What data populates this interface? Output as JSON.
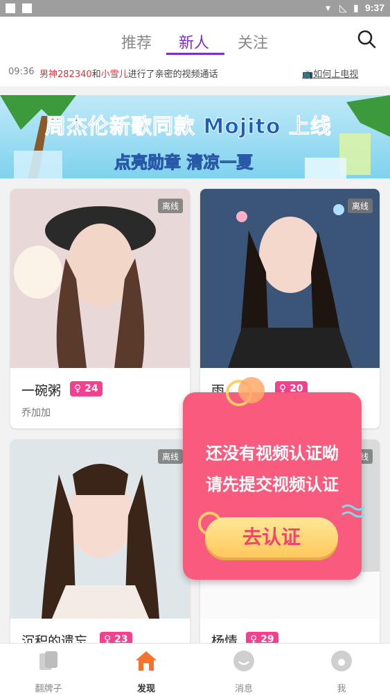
{
  "status_bar": {
    "time": "9:37"
  },
  "header": {
    "tabs": [
      {
        "label": "推荐"
      },
      {
        "label": "新人"
      },
      {
        "label": "关注"
      }
    ],
    "active_tab": "新人"
  },
  "ticker": {
    "time": "09:36",
    "user1": "男神282340",
    "and": "和",
    "user2": "小雪儿",
    "text": "进行了亲密的视频通话",
    "help_link": "如何上电视"
  },
  "banner": {
    "title": "周杰伦新歌同款 Mojito 上线",
    "subtitle": "点亮勋章  清凉一夏"
  },
  "cards": [
    {
      "status": "离线",
      "name": "一碗粥",
      "level": "24",
      "sub": "乔加加"
    },
    {
      "status": "离线",
      "name": "雨",
      "level": "20",
      "sub": ""
    },
    {
      "status": "离线",
      "name": "沉积的遗忘",
      "level": "23",
      "sub": ""
    },
    {
      "status": "离线",
      "name": "杨情",
      "level": "29",
      "sub": ""
    }
  ],
  "popup": {
    "line1": "还没有视频认证呦",
    "line2": "请先提交视频认证",
    "button": "去认证"
  },
  "nav": [
    {
      "label": "翻牌子"
    },
    {
      "label": "发现"
    },
    {
      "label": "消息"
    },
    {
      "label": "我"
    }
  ],
  "colors": {
    "accent": "#7b2fd0",
    "badge": "#f2428f",
    "popup": "#f85b7d",
    "nav_active": "#f4742e"
  }
}
